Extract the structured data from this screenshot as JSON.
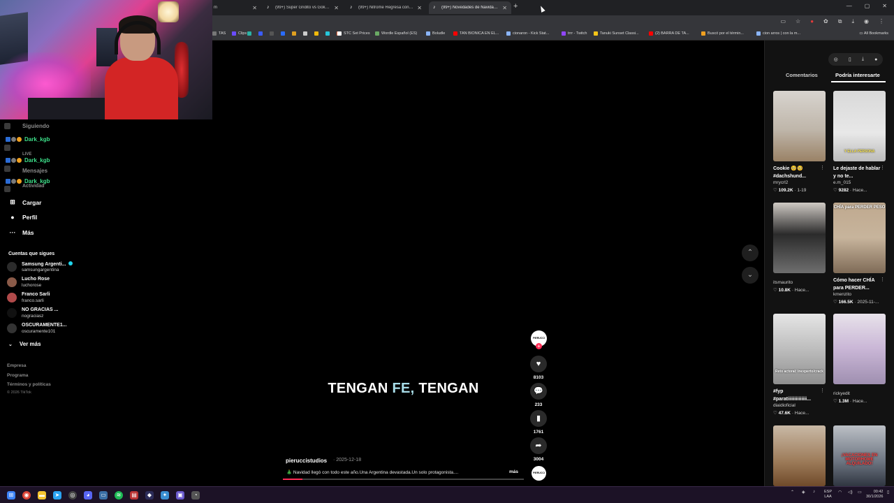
{
  "browser": {
    "tabs": [
      {
        "title": "m",
        "active": false
      },
      {
        "title": "(99+) Super Gridito vs Goku Hu...",
        "active": false
      },
      {
        "title": "(99+) Nitrome Regresa con Cli...",
        "active": false
      },
      {
        "title": "(99+) Novedades de Navidad en...",
        "active": true
      }
    ],
    "bookmarks": [
      {
        "label": "TAS",
        "color": "#777777"
      },
      {
        "label": "Clips",
        "color": "#6a4cff"
      },
      {
        "label": "",
        "color": "#2bb3a6"
      },
      {
        "label": "",
        "color": "#3b5cff"
      },
      {
        "label": "",
        "color": "#555555"
      },
      {
        "label": "",
        "color": "#2a6cff"
      },
      {
        "label": "",
        "color": "#e0a020"
      },
      {
        "label": "",
        "color": "#cccccc"
      },
      {
        "label": "",
        "color": "#f0b90b"
      },
      {
        "label": "",
        "color": "#26c6da"
      },
      {
        "label": "",
        "color": "#ff7043"
      },
      {
        "label": "STC Set Prices",
        "color": "#ffffff"
      },
      {
        "label": "Wordle Español (ES)",
        "color": "#6aaa64"
      },
      {
        "label": "Boludle",
        "color": "#8ab4f8"
      },
      {
        "label": "TAN BIONICA EN EL...",
        "color": "#ff0000"
      },
      {
        "label": "cionaron - Kick Stat...",
        "color": "#8ab4f8"
      },
      {
        "label": "trrr - Twitch",
        "color": "#9146ff"
      },
      {
        "label": "Tanuki Sunset Classi...",
        "color": "#f5c518"
      },
      {
        "label": "(2) BARRA DE TA...",
        "color": "#ff0000"
      },
      {
        "label": "Buscó por el términ...",
        "color": "#f0a020"
      },
      {
        "label": "cion arros | con la m...",
        "color": "#8ab4f8"
      }
    ],
    "all_bookmarks": "All Bookmarks"
  },
  "sidebar": {
    "nav_dim": [
      "Siguiendo",
      "LIVE",
      "Mensajes",
      "Actividad"
    ],
    "chat_user": "Dark_kgb",
    "nav": [
      {
        "label": "Cargar",
        "icon": "plus-square-icon"
      },
      {
        "label": "Perfil",
        "icon": "avatar-icon"
      },
      {
        "label": "Más",
        "icon": "more-icon"
      }
    ],
    "following_title": "Cuentas que sigues",
    "accounts": [
      {
        "name": "Samsung Argenti...",
        "handle": "samsungargentina",
        "verified": true,
        "color": "#2b2b2b"
      },
      {
        "name": "Lucho Rose",
        "handle": "luchorose",
        "verified": false,
        "color": "#8a5a48"
      },
      {
        "name": "Franco Sarli",
        "handle": "franco.sarli",
        "verified": false,
        "color": "#b04a4a"
      },
      {
        "name": "NO GRACIAS ...",
        "handle": "nograciasz",
        "verified": false,
        "color": "#111111"
      },
      {
        "name": "OSCURAMENTE1...",
        "handle": "oscuramente101",
        "verified": false,
        "color": "#333333"
      }
    ],
    "see_more": "Ver más",
    "footer": [
      "Empresa",
      "Programa",
      "Términos y políticas"
    ],
    "copyright": "© 2026 TikTok"
  },
  "video": {
    "caption_a": "TENGAN ",
    "caption_hl": "FE,",
    "caption_b": " TENGAN",
    "author": "pieruccistudios",
    "date": "· 2025-12-18",
    "description": "🎄 Navidad llegó con todo este año.Una Argentina devastada.Un solo protagonista....",
    "more": "más",
    "progress": 0.08,
    "avatar_text": "PIERUCCI",
    "likes": "8103",
    "comments": "233",
    "saves": "1761",
    "shares": "3004"
  },
  "right_panel": {
    "tab_comments": "Comentarios",
    "tab_interest": "Podría interesarte",
    "cards": [
      {
        "title": "Cookie 🥺🥺 #dachshund...",
        "author": "mrycrl2",
        "likes": "109.2K",
        "extra": "· 1-19",
        "bg": "linear-gradient(180deg,#d8d4cf 0%,#bfb6aa 55%,#9a8266 100%)",
        "overlay": ""
      },
      {
        "title": "Le dejaste de hablar y no te...",
        "author": "e.m_015",
        "likes": "9282",
        "extra": "· Hace...",
        "bg": "linear-gradient(180deg,#d9d9d9 0%,#e8e8e8 60%,#bcbcbc 100%)",
        "overlay": "Y ELLA PERSONA"
      },
      {
        "title": "",
        "author": "itsmaurito",
        "likes": "10.8K",
        "extra": "· Hace...",
        "bg": "linear-gradient(180deg,#cfcac4 0%,#2b2b2b 45%,#6e6e6e 100%)",
        "overlay": ""
      },
      {
        "title": "Cómo hacer CHÍA para PERDER...",
        "author": "kmenzito",
        "likes": "166.5K",
        "extra": "· 2025-11-...",
        "bg": "linear-gradient(180deg,#bfa98f 0%,#c7b49c 50%,#7f6b57 100%)",
        "overlay": "CHÍA para PERDER PESO"
      },
      {
        "title": "#fyp #paratiiiiiiiiiiiiii...",
        "author": "diaidioficial",
        "likes": "47.6K",
        "extra": "· Hace...",
        "bg": "linear-gradient(180deg,#e6e6e6 0%,#bdbdbd 50%,#8f8f8f 100%)",
        "overlay": "Reto actoral: inexperto/crack"
      },
      {
        "title": "",
        "author": "rickyedit",
        "likes": "1.3M",
        "extra": "· Hace...",
        "bg": "linear-gradient(180deg,#e8e2ea 0%,#c9b6d6 50%,#9f8fb0 100%)",
        "overlay": ""
      },
      {
        "title": "",
        "author": "",
        "likes": "",
        "extra": "",
        "bg": "linear-gradient(180deg,#c9b9a6 0%,#9c7a58 60%,#6f4a2a 100%)",
        "overlay": ""
      },
      {
        "title": "",
        "author": "",
        "likes": "",
        "extra": "",
        "bg": "linear-gradient(180deg,#bcc0c6 0%,#6c7480 60%,#2f3540 100%)",
        "overlay": "¡VACACIONES EN MOTORHOME ALQUILADO!"
      }
    ]
  },
  "taskbar": {
    "lang_top": "ESP",
    "lang_bottom": "LAA",
    "time": "00:42",
    "date": "30/1/2026"
  }
}
